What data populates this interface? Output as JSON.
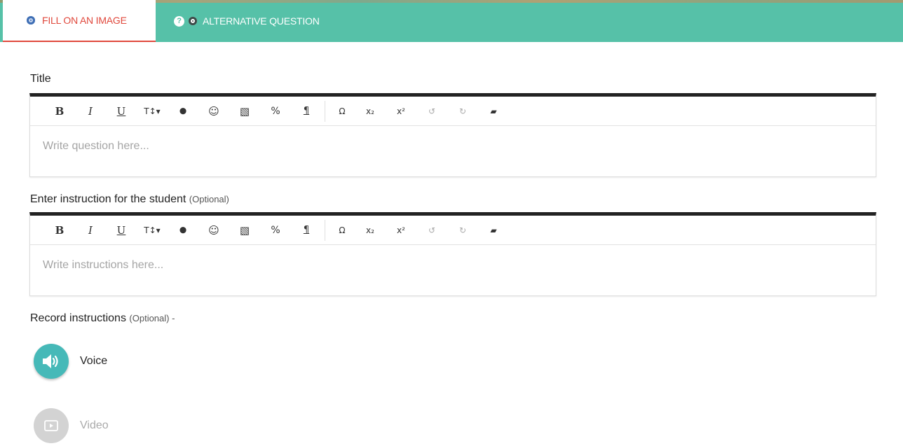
{
  "tabs": {
    "fill_label": "FILL ON AN IMAGE",
    "alt_label": "ALTERNATIVE QUESTION",
    "help_glyph": "?",
    "active_color": "#e0483c",
    "bar_color": "#56c1a8"
  },
  "title_section": {
    "label": "Title",
    "placeholder": "Write question here..."
  },
  "instruction_section": {
    "label": "Enter instruction for the student",
    "optional": "(Optional)",
    "placeholder": "Write instructions here..."
  },
  "toolbar": {
    "bold": "B",
    "italic": "I",
    "underline": "U",
    "font_size": "T↕▾",
    "color": "⬤",
    "emoji": "☺",
    "image": "▧",
    "link": "%",
    "paragraph": "¶",
    "special_char": "Ω",
    "subscript": "x₂",
    "superscript": "x²",
    "undo": "↺",
    "redo": "↻",
    "clear": "▰",
    "icons": [
      "bold-icon",
      "italic-icon",
      "underline-icon",
      "font-size-icon",
      "color-drop-icon",
      "emoji-icon",
      "image-icon",
      "link-icon",
      "paragraph-icon",
      "omega-icon",
      "subscript-icon",
      "superscript-icon",
      "undo-icon",
      "redo-icon",
      "eraser-icon"
    ]
  },
  "record_section": {
    "label": "Record instructions",
    "optional": "(Optional) -",
    "voice_label": "Voice",
    "video_label": "Video"
  }
}
